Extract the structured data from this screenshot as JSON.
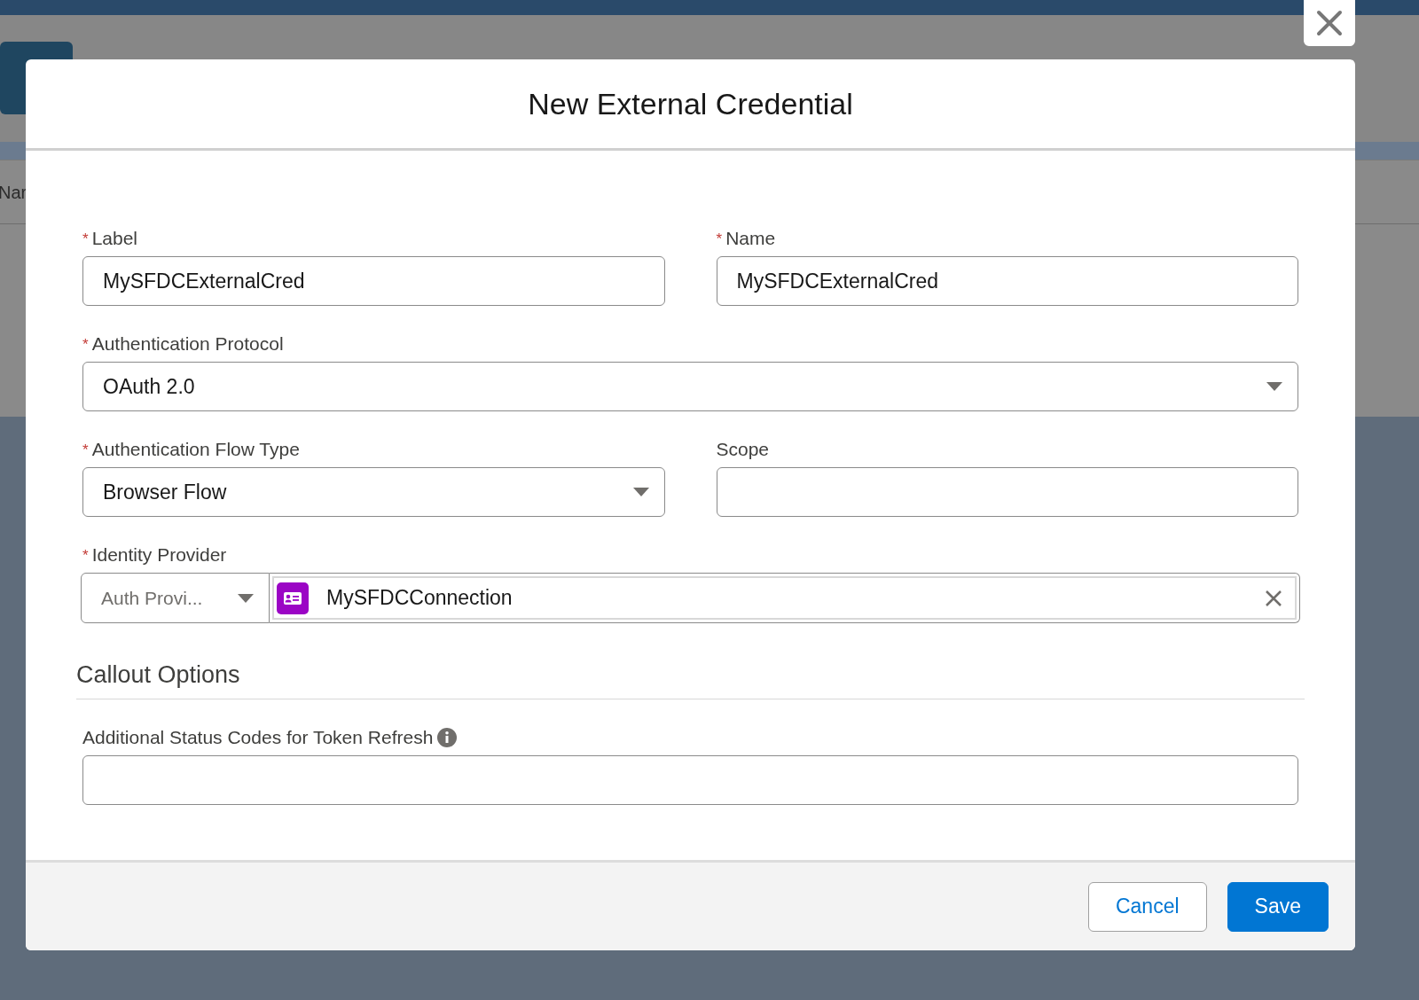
{
  "background": {
    "column_heading": "Nar"
  },
  "modal": {
    "title": "New External Credential",
    "rows": [
      [
        {
          "kind": "text",
          "label": "Label",
          "required_mark": "*",
          "value": "MySFDCExternalCred"
        },
        {
          "kind": "text",
          "label": "Name",
          "required_mark": "*",
          "value": "MySFDCExternalCred"
        }
      ],
      [
        {
          "kind": "select",
          "label": "Authentication Protocol",
          "required_mark": "*",
          "value": "OAuth 2.0"
        }
      ],
      [
        {
          "kind": "select",
          "label": "Authentication Flow Type",
          "required_mark": "*",
          "value": "Browser Flow"
        },
        {
          "kind": "text",
          "label": "Scope"
        }
      ],
      [
        {
          "kind": "lookup",
          "label": "Identity Provider",
          "required_mark": "*",
          "type_value": "Auth Provi...",
          "value": "MySFDCConnection"
        }
      ]
    ],
    "section": {
      "title": "Callout Options",
      "rows": [
        [
          {
            "kind": "text",
            "label": "Additional Status Codes for Token Refresh",
            "info": true
          }
        ]
      ]
    },
    "buttons": [
      {
        "label": "Cancel",
        "kind": "neutral"
      },
      {
        "label": "Save",
        "kind": "brand"
      }
    ]
  }
}
